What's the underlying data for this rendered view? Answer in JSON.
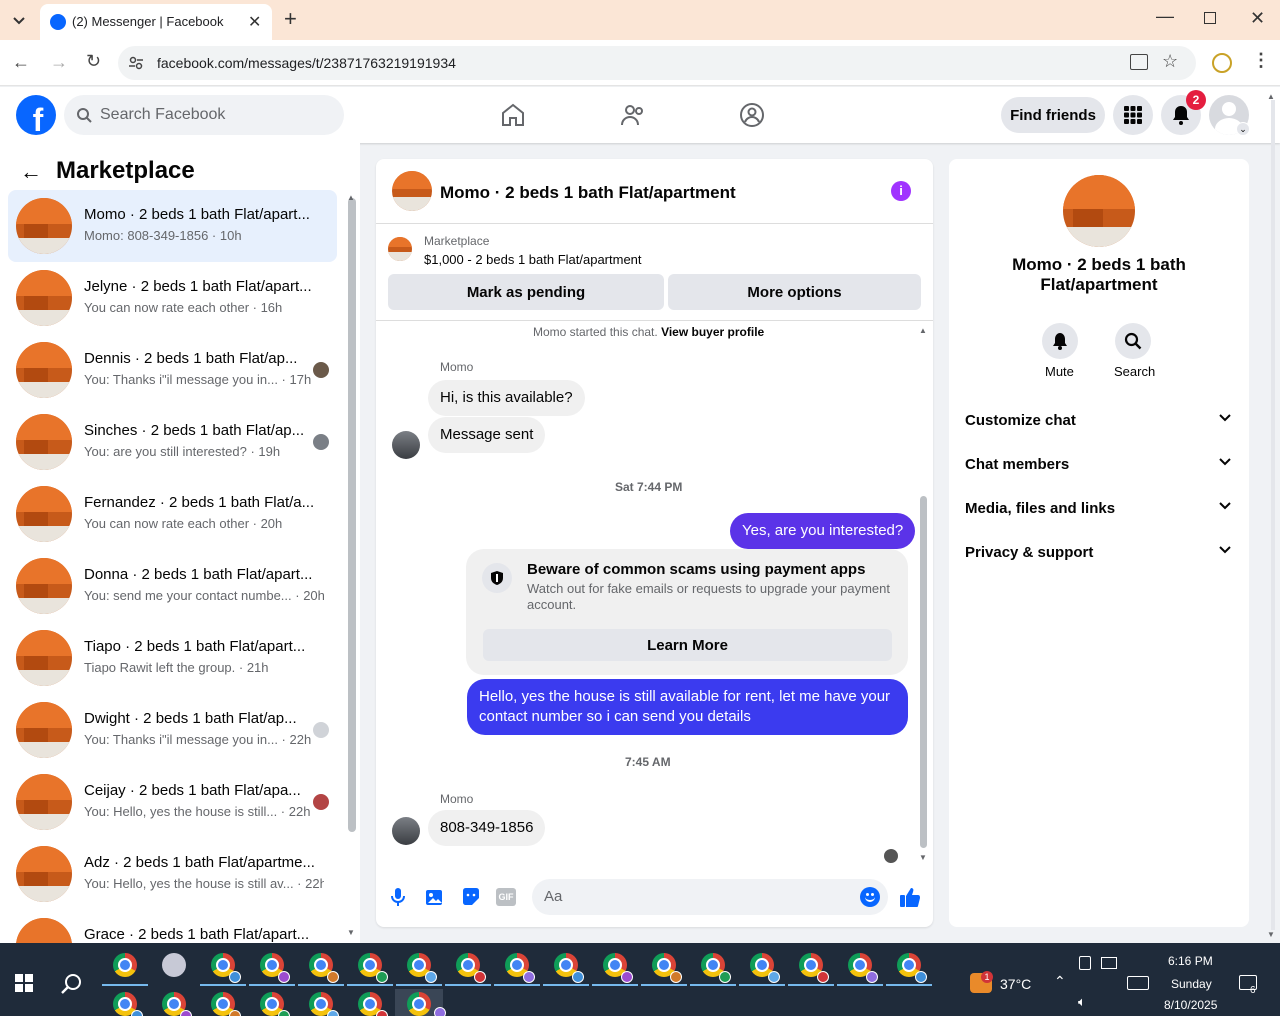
{
  "browser": {
    "tab_title": "(2) Messenger | Facebook",
    "url": "facebook.com/messages/t/23871763219191934"
  },
  "header": {
    "search_placeholder": "Search Facebook",
    "find_friends": "Find friends",
    "notif_count": "2"
  },
  "sidebar": {
    "title": "Marketplace",
    "conversations": [
      {
        "title": "Momo · 2 beds 1 bath Flat/apart...",
        "sub": "Momo: 808-349-1856 · 10h",
        "selected": true
      },
      {
        "title": "Jelyne · 2 beds 1 bath Flat/apart...",
        "sub": "You can now rate each other · 16h"
      },
      {
        "title": "Dennis · 2 beds 1 bath Flat/ap...",
        "sub": "You: Thanks i\"il message you in... · 17h"
      },
      {
        "title": "Sinches · 2 beds 1 bath Flat/ap...",
        "sub": "You: are you still interested? · 19h"
      },
      {
        "title": "Fernandez · 2 beds 1 bath Flat/a...",
        "sub": "You can now rate each other · 20h"
      },
      {
        "title": "Donna · 2 beds 1 bath Flat/apart...",
        "sub": "You: send me your contact numbe... · 20h"
      },
      {
        "title": "Tiapo · 2 beds 1 bath Flat/apart...",
        "sub": "Tiapo Rawit left the group. · 21h"
      },
      {
        "title": "Dwight · 2 beds 1 bath Flat/ap...",
        "sub": "You: Thanks i\"il message you in... · 22h"
      },
      {
        "title": "Ceijay · 2 beds 1 bath Flat/apa...",
        "sub": "You: Hello, yes the house is still... · 22h"
      },
      {
        "title": "Adz · 2 beds 1 bath Flat/apartme...",
        "sub": "You: Hello, yes the house is still av... · 22h"
      },
      {
        "title": "Grace · 2 beds 1 bath Flat/apart...",
        "sub": ""
      }
    ]
  },
  "chat": {
    "title": "Momo · 2 beds 1 bath Flat/apartment",
    "listing_source": "Marketplace",
    "listing_desc": "$1,000 - 2 beds 1 bath Flat/apartment",
    "mark_pending": "Mark as pending",
    "more_options": "More options",
    "started": "Momo started this chat.",
    "view_profile": "View buyer profile",
    "sender_name": "Momo",
    "msg1": "Hi, is this available?",
    "msg2": "Message sent",
    "time1": "Sat 7:44 PM",
    "msg3": "Yes, are you interested?",
    "scam_title": "Beware of common scams using payment apps",
    "scam_text": "Watch out for fake emails or requests to upgrade your payment account.",
    "learn_more": "Learn More",
    "msg4": "Hello, yes the house is still available for rent, let me have your contact number so i can send you details",
    "time2": "7:45 AM",
    "sender_name2": "Momo",
    "msg5": "808-349-1856",
    "composer_placeholder": "Aa"
  },
  "info": {
    "name": "Momo · 2 beds 1 bath Flat/apartment",
    "mute": "Mute",
    "search": "Search",
    "sections": [
      "Customize chat",
      "Chat members",
      "Media, files and links",
      "Privacy & support"
    ]
  },
  "taskbar": {
    "temp": "37°C",
    "weather_badge": "1",
    "time": "6:16 PM",
    "day": "Sunday",
    "date": "8/10/2025",
    "notif": "6"
  },
  "colors": {
    "fb_blue": "#0866ff",
    "accent_purple": "#a033ff",
    "out_bubble": "#4f36e8"
  }
}
